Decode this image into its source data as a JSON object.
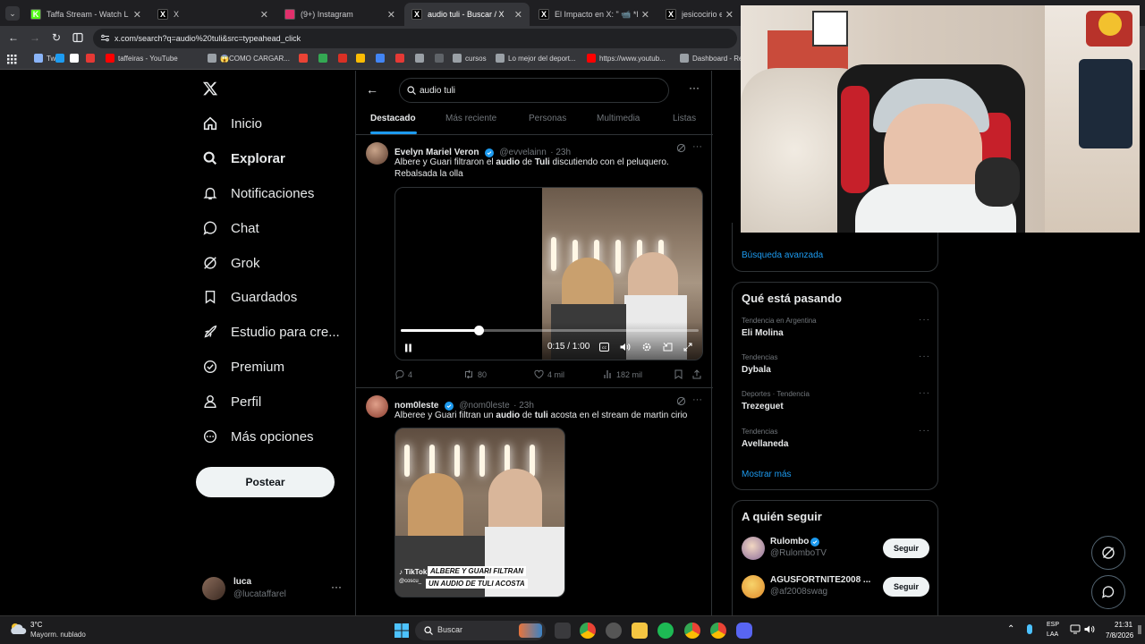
{
  "browser": {
    "tabs": [
      {
        "title": "Taffa Stream - Watch L",
        "favicon": "K",
        "fav_color": "#53fc18",
        "active": false
      },
      {
        "title": "X",
        "favicon": "X",
        "fav_color": "#000000",
        "active": false
      },
      {
        "title": "(9+) Instagram",
        "favicon": "ig",
        "fav_color": "#e1306c",
        "active": false
      },
      {
        "title": "audio tuli - Buscar / X",
        "favicon": "X",
        "fav_color": "#000000",
        "active": true
      },
      {
        "title": "El Impacto en X: \" 📹 *INV",
        "favicon": "X",
        "fav_color": "#000000",
        "active": false
      },
      {
        "title": "jesicocirio en X: \"Ma",
        "favicon": "X",
        "fav_color": "#000000",
        "active": false
      }
    ],
    "url": "x.com/search?q=audio%20tuli&src=typeahead_click",
    "bookmarks": [
      {
        "label": "Tw",
        "color": "#8ab4f8"
      },
      {
        "label": "",
        "color": "#1d9bf0"
      },
      {
        "label": "",
        "color": "#ffffff"
      },
      {
        "label": "",
        "color": "#e53935"
      },
      {
        "label": "taffeiras - YouTube",
        "color": "#ff0000"
      },
      {
        "label": "😱COMO CARGAR...",
        "color": "#9aa0a6"
      },
      {
        "label": "",
        "color": "#ea4335"
      },
      {
        "label": "",
        "color": "#34a853"
      },
      {
        "label": "",
        "color": "#d93025"
      },
      {
        "label": "",
        "color": "#fbbc04"
      },
      {
        "label": "",
        "color": "#4285f4"
      },
      {
        "label": "",
        "color": "#e53935"
      },
      {
        "label": "",
        "color": "#9aa0a6"
      },
      {
        "label": "",
        "color": "#5f6368"
      },
      {
        "label": "cursos",
        "color": "#9aa0a6"
      },
      {
        "label": "Lo mejor del deport...",
        "color": "#9aa0a6"
      },
      {
        "label": "https://www.youtub...",
        "color": "#ff0000"
      },
      {
        "label": "Dashboard - Re",
        "color": "#9aa0a6"
      }
    ]
  },
  "nav": {
    "items": [
      {
        "label": "Inicio",
        "icon": "home-icon"
      },
      {
        "label": "Explorar",
        "icon": "search-icon"
      },
      {
        "label": "Notificaciones",
        "icon": "bell-icon"
      },
      {
        "label": "Chat",
        "icon": "chat-icon"
      },
      {
        "label": "Grok",
        "icon": "grok-icon"
      },
      {
        "label": "Guardados",
        "icon": "bookmark-icon"
      },
      {
        "label": "Estudio para cre...",
        "icon": "rocket-icon"
      },
      {
        "label": "Premium",
        "icon": "verified-icon"
      },
      {
        "label": "Perfil",
        "icon": "person-icon"
      },
      {
        "label": "Más opciones",
        "icon": "more-circle-icon"
      }
    ],
    "post_label": "Postear",
    "account": {
      "name": "luca",
      "handle": "@lucataffarel"
    }
  },
  "search": {
    "query": "audio tuli",
    "tabs": [
      "Destacado",
      "Más reciente",
      "Personas",
      "Multimedia",
      "Listas"
    ],
    "active_tab": "Destacado"
  },
  "tweets": [
    {
      "name": "Evelyn Mariel Veron",
      "handle": "@evvelainn",
      "time": "23h",
      "text_parts": [
        "Albere y Guari filtraron el ",
        "audio",
        " de ",
        "Tuli",
        " discutiendo con el peluquero. Rebalsada la olla"
      ],
      "video_time": "0:15 / 1:00",
      "video_progress": 0.26,
      "replies": "4",
      "reposts": "80",
      "likes": "4 mil",
      "views": "182 mil"
    },
    {
      "name": "nom0leste",
      "handle": "@nom0leste",
      "time": "23h",
      "text_parts": [
        "Alberee y Guari filtran un ",
        "audio",
        " de ",
        "tuli",
        " acosta en el stream de martin cirio"
      ],
      "overlay_text_1": "ALBERE Y GUARI FILTRAN",
      "overlay_text_2": "UN AUDIO DE TULI ACOSTA",
      "watermark": "TikTok",
      "watermark_handle": "@coscu_"
    }
  ],
  "right": {
    "advanced_search": "Búsqueda avanzada",
    "trends_title": "Qué está pasando",
    "trends": [
      {
        "category": "Tendencia en Argentina",
        "name": "Eli Molina"
      },
      {
        "category": "Tendencias",
        "name": "Dybala"
      },
      {
        "category": "Deportes · Tendencia",
        "name": "Trezeguet"
      },
      {
        "category": "Tendencias",
        "name": "Avellaneda"
      }
    ],
    "show_more": "Mostrar más",
    "follow_title": "A quién seguir",
    "suggestions": [
      {
        "name": "Rulombo",
        "handle": "@RulomboTV",
        "verified": true
      },
      {
        "name": "AGUSFORTNITE2008 ...",
        "handle": "@af2008swag",
        "verified": false
      }
    ],
    "follow_label": "Seguir"
  },
  "taskbar": {
    "weather_temp": "3°C",
    "weather_desc": "Mayorm. nublado",
    "search_placeholder": "Buscar",
    "lang_1": "ESP",
    "lang_2": "LAA",
    "time": "21:31",
    "date": "7/8/2026"
  },
  "colors": {
    "accent": "#1d9bf0",
    "bg": "#000000",
    "border": "#2f3336",
    "muted": "#71767b"
  }
}
